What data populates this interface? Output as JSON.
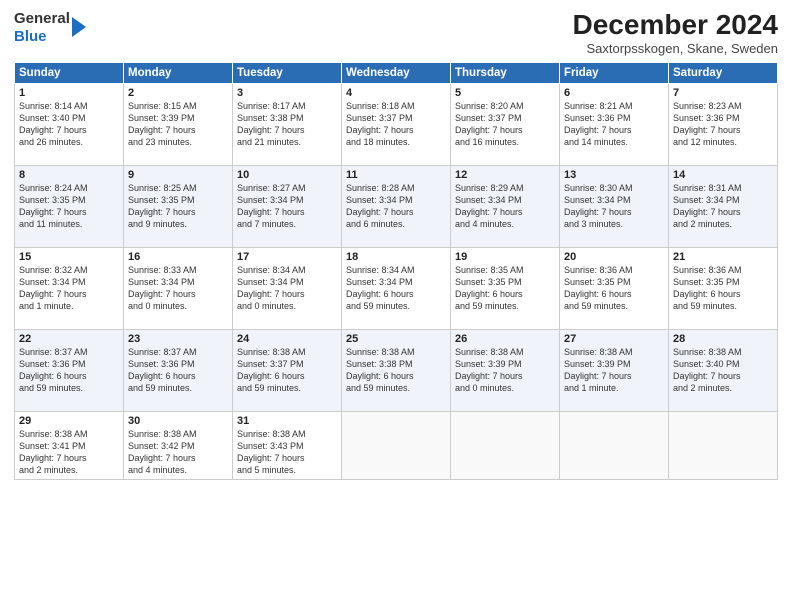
{
  "header": {
    "logo_line1": "General",
    "logo_line2": "Blue",
    "month_title": "December 2024",
    "location": "Saxtorpsskogen, Skane, Sweden"
  },
  "days_of_week": [
    "Sunday",
    "Monday",
    "Tuesday",
    "Wednesday",
    "Thursday",
    "Friday",
    "Saturday"
  ],
  "weeks": [
    [
      {
        "day": "1",
        "lines": [
          "Sunrise: 8:14 AM",
          "Sunset: 3:40 PM",
          "Daylight: 7 hours",
          "and 26 minutes."
        ]
      },
      {
        "day": "2",
        "lines": [
          "Sunrise: 8:15 AM",
          "Sunset: 3:39 PM",
          "Daylight: 7 hours",
          "and 23 minutes."
        ]
      },
      {
        "day": "3",
        "lines": [
          "Sunrise: 8:17 AM",
          "Sunset: 3:38 PM",
          "Daylight: 7 hours",
          "and 21 minutes."
        ]
      },
      {
        "day": "4",
        "lines": [
          "Sunrise: 8:18 AM",
          "Sunset: 3:37 PM",
          "Daylight: 7 hours",
          "and 18 minutes."
        ]
      },
      {
        "day": "5",
        "lines": [
          "Sunrise: 8:20 AM",
          "Sunset: 3:37 PM",
          "Daylight: 7 hours",
          "and 16 minutes."
        ]
      },
      {
        "day": "6",
        "lines": [
          "Sunrise: 8:21 AM",
          "Sunset: 3:36 PM",
          "Daylight: 7 hours",
          "and 14 minutes."
        ]
      },
      {
        "day": "7",
        "lines": [
          "Sunrise: 8:23 AM",
          "Sunset: 3:36 PM",
          "Daylight: 7 hours",
          "and 12 minutes."
        ]
      }
    ],
    [
      {
        "day": "8",
        "lines": [
          "Sunrise: 8:24 AM",
          "Sunset: 3:35 PM",
          "Daylight: 7 hours",
          "and 11 minutes."
        ]
      },
      {
        "day": "9",
        "lines": [
          "Sunrise: 8:25 AM",
          "Sunset: 3:35 PM",
          "Daylight: 7 hours",
          "and 9 minutes."
        ]
      },
      {
        "day": "10",
        "lines": [
          "Sunrise: 8:27 AM",
          "Sunset: 3:34 PM",
          "Daylight: 7 hours",
          "and 7 minutes."
        ]
      },
      {
        "day": "11",
        "lines": [
          "Sunrise: 8:28 AM",
          "Sunset: 3:34 PM",
          "Daylight: 7 hours",
          "and 6 minutes."
        ]
      },
      {
        "day": "12",
        "lines": [
          "Sunrise: 8:29 AM",
          "Sunset: 3:34 PM",
          "Daylight: 7 hours",
          "and 4 minutes."
        ]
      },
      {
        "day": "13",
        "lines": [
          "Sunrise: 8:30 AM",
          "Sunset: 3:34 PM",
          "Daylight: 7 hours",
          "and 3 minutes."
        ]
      },
      {
        "day": "14",
        "lines": [
          "Sunrise: 8:31 AM",
          "Sunset: 3:34 PM",
          "Daylight: 7 hours",
          "and 2 minutes."
        ]
      }
    ],
    [
      {
        "day": "15",
        "lines": [
          "Sunrise: 8:32 AM",
          "Sunset: 3:34 PM",
          "Daylight: 7 hours",
          "and 1 minute."
        ]
      },
      {
        "day": "16",
        "lines": [
          "Sunrise: 8:33 AM",
          "Sunset: 3:34 PM",
          "Daylight: 7 hours",
          "and 0 minutes."
        ]
      },
      {
        "day": "17",
        "lines": [
          "Sunrise: 8:34 AM",
          "Sunset: 3:34 PM",
          "Daylight: 7 hours",
          "and 0 minutes."
        ]
      },
      {
        "day": "18",
        "lines": [
          "Sunrise: 8:34 AM",
          "Sunset: 3:34 PM",
          "Daylight: 6 hours",
          "and 59 minutes."
        ]
      },
      {
        "day": "19",
        "lines": [
          "Sunrise: 8:35 AM",
          "Sunset: 3:35 PM",
          "Daylight: 6 hours",
          "and 59 minutes."
        ]
      },
      {
        "day": "20",
        "lines": [
          "Sunrise: 8:36 AM",
          "Sunset: 3:35 PM",
          "Daylight: 6 hours",
          "and 59 minutes."
        ]
      },
      {
        "day": "21",
        "lines": [
          "Sunrise: 8:36 AM",
          "Sunset: 3:35 PM",
          "Daylight: 6 hours",
          "and 59 minutes."
        ]
      }
    ],
    [
      {
        "day": "22",
        "lines": [
          "Sunrise: 8:37 AM",
          "Sunset: 3:36 PM",
          "Daylight: 6 hours",
          "and 59 minutes."
        ]
      },
      {
        "day": "23",
        "lines": [
          "Sunrise: 8:37 AM",
          "Sunset: 3:36 PM",
          "Daylight: 6 hours",
          "and 59 minutes."
        ]
      },
      {
        "day": "24",
        "lines": [
          "Sunrise: 8:38 AM",
          "Sunset: 3:37 PM",
          "Daylight: 6 hours",
          "and 59 minutes."
        ]
      },
      {
        "day": "25",
        "lines": [
          "Sunrise: 8:38 AM",
          "Sunset: 3:38 PM",
          "Daylight: 6 hours",
          "and 59 minutes."
        ]
      },
      {
        "day": "26",
        "lines": [
          "Sunrise: 8:38 AM",
          "Sunset: 3:39 PM",
          "Daylight: 7 hours",
          "and 0 minutes."
        ]
      },
      {
        "day": "27",
        "lines": [
          "Sunrise: 8:38 AM",
          "Sunset: 3:39 PM",
          "Daylight: 7 hours",
          "and 1 minute."
        ]
      },
      {
        "day": "28",
        "lines": [
          "Sunrise: 8:38 AM",
          "Sunset: 3:40 PM",
          "Daylight: 7 hours",
          "and 2 minutes."
        ]
      }
    ],
    [
      {
        "day": "29",
        "lines": [
          "Sunrise: 8:38 AM",
          "Sunset: 3:41 PM",
          "Daylight: 7 hours",
          "and 2 minutes."
        ]
      },
      {
        "day": "30",
        "lines": [
          "Sunrise: 8:38 AM",
          "Sunset: 3:42 PM",
          "Daylight: 7 hours",
          "and 4 minutes."
        ]
      },
      {
        "day": "31",
        "lines": [
          "Sunrise: 8:38 AM",
          "Sunset: 3:43 PM",
          "Daylight: 7 hours",
          "and 5 minutes."
        ]
      },
      {
        "day": "",
        "lines": []
      },
      {
        "day": "",
        "lines": []
      },
      {
        "day": "",
        "lines": []
      },
      {
        "day": "",
        "lines": []
      }
    ]
  ]
}
